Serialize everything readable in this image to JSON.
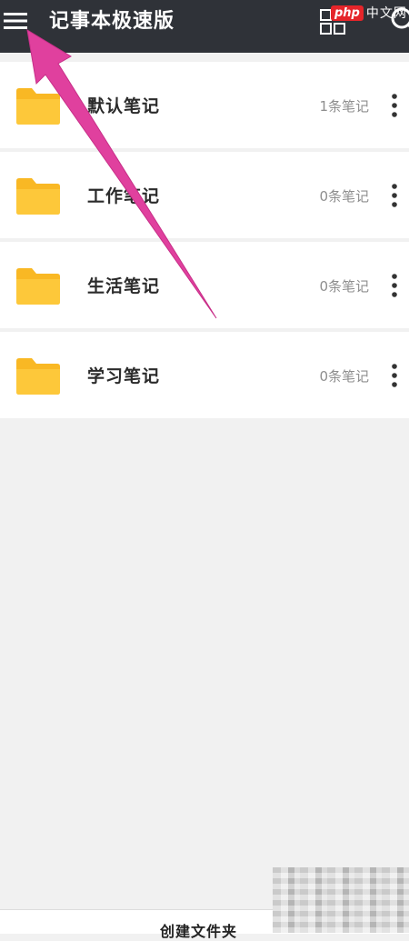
{
  "appbar": {
    "title": "记事本极速版",
    "menu_icon": "hamburger-menu-icon",
    "grid_icon": "grid-view-icon",
    "search_icon": "search-icon",
    "background": "#2f3238"
  },
  "watermark": {
    "badge": "php",
    "text": "中文网"
  },
  "folders": [
    {
      "name": "默认笔记",
      "count": "1条笔记"
    },
    {
      "name": "工作笔记",
      "count": "0条笔记"
    },
    {
      "name": "生活笔记",
      "count": "0条笔记"
    },
    {
      "name": "学习笔记",
      "count": "0条笔记"
    }
  ],
  "folder_icon": "folder-icon",
  "folder_color": "#fbc02d",
  "more_icon": "more-vertical-icon",
  "bottom": {
    "create_label": "创建文件夹"
  },
  "annotation": {
    "arrow_color": "#e0409e"
  }
}
